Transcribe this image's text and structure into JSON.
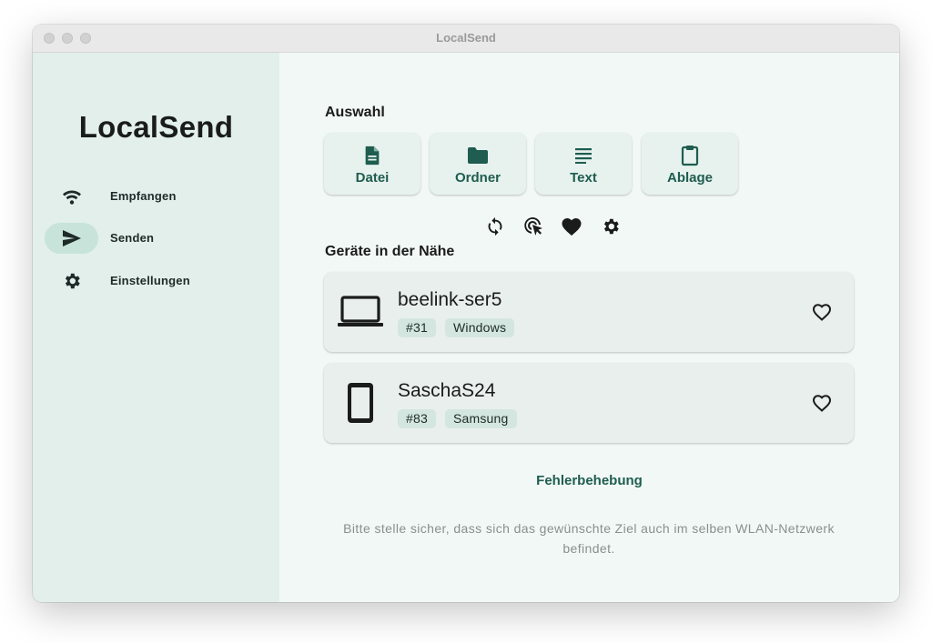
{
  "window": {
    "title": "LocalSend"
  },
  "colors": {
    "accent": "#1e5d4f",
    "sidebar_bg": "#e2efeb",
    "main_bg": "#f2f8f6",
    "active_nav_bg": "#c7e3da"
  },
  "sidebar": {
    "app_name": "LocalSend",
    "items": [
      {
        "label": "Empfangen",
        "icon": "wifi-icon",
        "active": false
      },
      {
        "label": "Senden",
        "icon": "send-icon",
        "active": true
      },
      {
        "label": "Einstellungen",
        "icon": "gear-icon",
        "active": false
      }
    ]
  },
  "selection": {
    "title": "Auswahl",
    "buttons": [
      {
        "label": "Datei",
        "icon": "file-icon"
      },
      {
        "label": "Ordner",
        "icon": "folder-icon"
      },
      {
        "label": "Text",
        "icon": "text-icon"
      },
      {
        "label": "Ablage",
        "icon": "clipboard-icon"
      }
    ]
  },
  "nearby": {
    "title": "Geräte in der Nähe",
    "tools": [
      "refresh-icon",
      "tap-target-icon",
      "favorites-icon",
      "settings-icon"
    ],
    "devices": [
      {
        "name": "beelink-ser5",
        "id": "#31",
        "type": "Windows",
        "icon": "laptop-icon"
      },
      {
        "name": "SaschaS24",
        "id": "#83",
        "type": "Samsung",
        "icon": "phone-icon"
      }
    ]
  },
  "troubleshoot_label": "Fehlerbehebung",
  "hint_text": "Bitte stelle sicher, dass sich das gewünschte Ziel auch im selben WLAN-Netzwerk befindet."
}
